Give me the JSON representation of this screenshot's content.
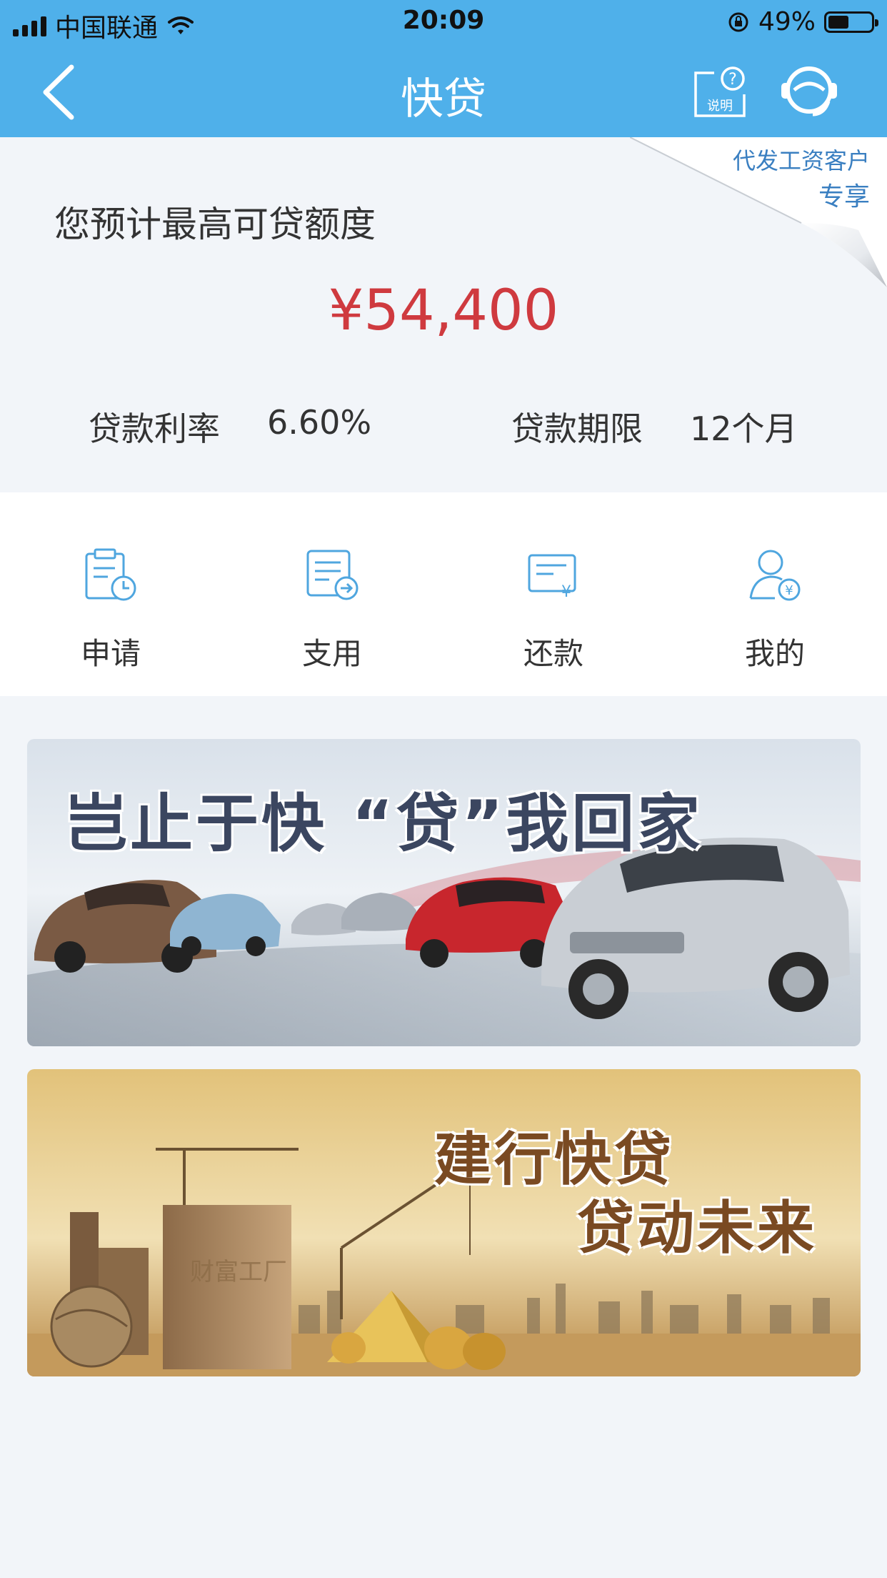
{
  "status_bar": {
    "carrier": "中国联通",
    "time": "20:09",
    "battery_text": "49%",
    "battery_level": 0.49
  },
  "nav": {
    "title": "快贷",
    "help_label": "说明",
    "back_icon": "chevron-left-icon",
    "help_icon": "help-document-icon",
    "service_icon": "customer-service-icon"
  },
  "quota": {
    "badge_line1": "代发工资客户",
    "badge_line2": "专享",
    "label": "您预计最高可贷额度",
    "amount": "¥54,400",
    "rate_label": "贷款利率",
    "rate_value": "6.60%",
    "term_label": "贷款期限",
    "term_value": "12个月"
  },
  "menu": {
    "items": [
      {
        "label": "申请",
        "icon": "apply-icon"
      },
      {
        "label": "支用",
        "icon": "withdraw-icon"
      },
      {
        "label": "还款",
        "icon": "repay-icon"
      },
      {
        "label": "我的",
        "icon": "profile-icon"
      }
    ]
  },
  "banners": {
    "banner1_text": "岂止于快 “贷”我回家",
    "banner2_line1": "建行快贷",
    "banner2_line2": "贷动未来",
    "banner2_box_text": "财富工厂"
  },
  "colors": {
    "header": "#4fb0ea",
    "amount": "#cf3a3f",
    "icon": "#4fa6df",
    "badge_text": "#3a7fc1"
  }
}
